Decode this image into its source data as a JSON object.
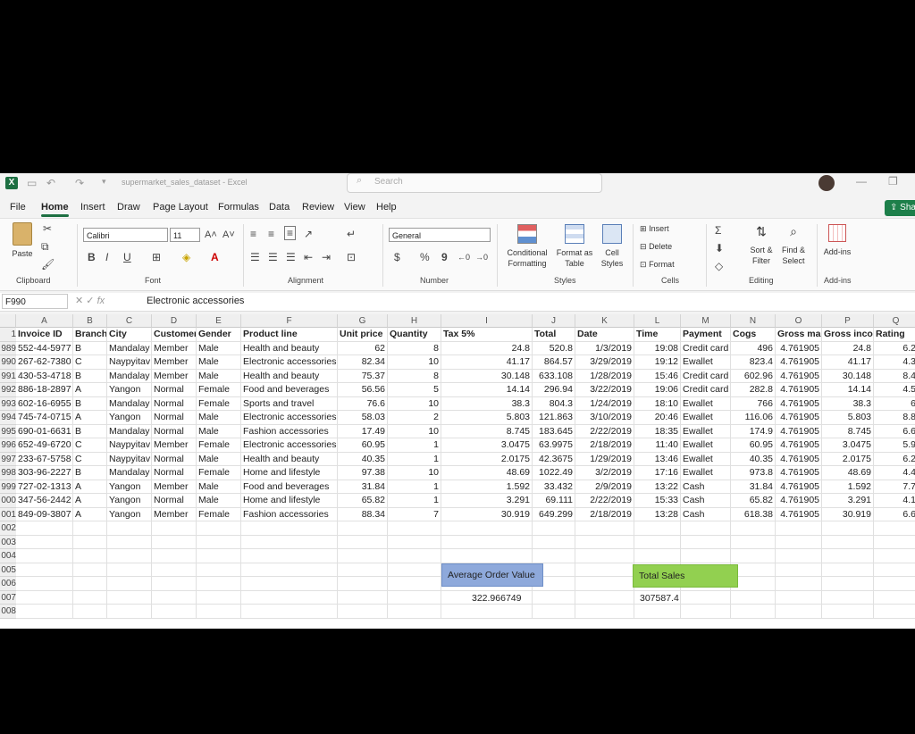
{
  "app": {
    "file_name": "supermarket_sales_dataset",
    "app_name": "Excel",
    "search_placeholder": "Search",
    "share_label": "Sha"
  },
  "menu": [
    "File",
    "Home",
    "Insert",
    "Draw",
    "Page Layout",
    "Formulas",
    "Data",
    "Review",
    "View",
    "Help"
  ],
  "ribbon": {
    "clipboard": {
      "paste": "Paste",
      "label": "Clipboard"
    },
    "font": {
      "name": "Calibri",
      "size": "11",
      "label": "Font",
      "bold": "B",
      "italic": "I",
      "underline": "U"
    },
    "alignment": {
      "label": "Alignment"
    },
    "number": {
      "format": "General",
      "label": "Number",
      "currency": "$",
      "percent": "%",
      "comma": "9"
    },
    "styles": {
      "conditional": "Conditional Formatting",
      "format_table": "Format as Table",
      "cell_styles": "Cell Styles",
      "label": "Styles"
    },
    "cells": {
      "insert": "Insert",
      "delete": "Delete",
      "format": "Format",
      "label": "Cells"
    },
    "editing": {
      "sort": "Sort & Filter",
      "find": "Find & Select",
      "label": "Editing"
    },
    "addins": {
      "button": "Add-ins",
      "label": "Add-ins"
    }
  },
  "formula_bar": {
    "name_box": "F990",
    "fx": "fx",
    "content": "Electronic accessories"
  },
  "columns": [
    "A",
    "B",
    "C",
    "D",
    "E",
    "F",
    "G",
    "H",
    "I",
    "J",
    "K",
    "L",
    "M",
    "N",
    "O",
    "P",
    "Q"
  ],
  "header_row": {
    "row_number": "1",
    "cells": [
      "Invoice ID",
      "Branch",
      "City",
      "Customer",
      "Gender",
      "Product line",
      "Unit price",
      "Quantity",
      "Tax 5%",
      "Total",
      "Date",
      "Time",
      "Payment",
      "Cogs",
      "Gross mar",
      "Gross incor",
      "Rating"
    ]
  },
  "rows": [
    {
      "n": "989",
      "c": [
        "552-44-5977",
        "B",
        "Mandalay",
        "Member",
        "Male",
        "Health and beauty",
        "62",
        "8",
        "24.8",
        "520.8",
        "1/3/2019",
        "19:08",
        "Credit card",
        "496",
        "4.761905",
        "24.8",
        "6.2"
      ]
    },
    {
      "n": "990",
      "c": [
        "267-62-7380",
        "C",
        "Naypyitav",
        "Member",
        "Male",
        "Electronic accessories",
        "82.34",
        "10",
        "41.17",
        "864.57",
        "3/29/2019",
        "19:12",
        "Ewallet",
        "823.4",
        "4.761905",
        "41.17",
        "4.3"
      ]
    },
    {
      "n": "991",
      "c": [
        "430-53-4718",
        "B",
        "Mandalay",
        "Member",
        "Male",
        "Health and beauty",
        "75.37",
        "8",
        "30.148",
        "633.108",
        "1/28/2019",
        "15:46",
        "Credit card",
        "602.96",
        "4.761905",
        "30.148",
        "8.4"
      ]
    },
    {
      "n": "992",
      "c": [
        "886-18-2897",
        "A",
        "Yangon",
        "Normal",
        "Female",
        "Food and beverages",
        "56.56",
        "5",
        "14.14",
        "296.94",
        "3/22/2019",
        "19:06",
        "Credit card",
        "282.8",
        "4.761905",
        "14.14",
        "4.5"
      ]
    },
    {
      "n": "993",
      "c": [
        "602-16-6955",
        "B",
        "Mandalay",
        "Normal",
        "Female",
        "Sports and travel",
        "76.6",
        "10",
        "38.3",
        "804.3",
        "1/24/2019",
        "18:10",
        "Ewallet",
        "766",
        "4.761905",
        "38.3",
        "6"
      ]
    },
    {
      "n": "994",
      "c": [
        "745-74-0715",
        "A",
        "Yangon",
        "Normal",
        "Male",
        "Electronic accessories",
        "58.03",
        "2",
        "5.803",
        "121.863",
        "3/10/2019",
        "20:46",
        "Ewallet",
        "116.06",
        "4.761905",
        "5.803",
        "8.8"
      ]
    },
    {
      "n": "995",
      "c": [
        "690-01-6631",
        "B",
        "Mandalay",
        "Normal",
        "Male",
        "Fashion accessories",
        "17.49",
        "10",
        "8.745",
        "183.645",
        "2/22/2019",
        "18:35",
        "Ewallet",
        "174.9",
        "4.761905",
        "8.745",
        "6.6"
      ]
    },
    {
      "n": "996",
      "c": [
        "652-49-6720",
        "C",
        "Naypyitav",
        "Member",
        "Female",
        "Electronic accessories",
        "60.95",
        "1",
        "3.0475",
        "63.9975",
        "2/18/2019",
        "11:40",
        "Ewallet",
        "60.95",
        "4.761905",
        "3.0475",
        "5.9"
      ]
    },
    {
      "n": "997",
      "c": [
        "233-67-5758",
        "C",
        "Naypyitav",
        "Normal",
        "Male",
        "Health and beauty",
        "40.35",
        "1",
        "2.0175",
        "42.3675",
        "1/29/2019",
        "13:46",
        "Ewallet",
        "40.35",
        "4.761905",
        "2.0175",
        "6.2"
      ]
    },
    {
      "n": "998",
      "c": [
        "303-96-2227",
        "B",
        "Mandalay",
        "Normal",
        "Female",
        "Home and lifestyle",
        "97.38",
        "10",
        "48.69",
        "1022.49",
        "3/2/2019",
        "17:16",
        "Ewallet",
        "973.8",
        "4.761905",
        "48.69",
        "4.4"
      ]
    },
    {
      "n": "999",
      "c": [
        "727-02-1313",
        "A",
        "Yangon",
        "Member",
        "Male",
        "Food and beverages",
        "31.84",
        "1",
        "1.592",
        "33.432",
        "2/9/2019",
        "13:22",
        "Cash",
        "31.84",
        "4.761905",
        "1.592",
        "7.7"
      ]
    },
    {
      "n": "000",
      "c": [
        "347-56-2442",
        "A",
        "Yangon",
        "Normal",
        "Male",
        "Home and lifestyle",
        "65.82",
        "1",
        "3.291",
        "69.111",
        "2/22/2019",
        "15:33",
        "Cash",
        "65.82",
        "4.761905",
        "3.291",
        "4.1"
      ]
    },
    {
      "n": "001",
      "c": [
        "849-09-3807",
        "A",
        "Yangon",
        "Member",
        "Female",
        "Fashion accessories",
        "88.34",
        "7",
        "30.919",
        "649.299",
        "2/18/2019",
        "13:28",
        "Cash",
        "618.38",
        "4.761905",
        "30.919",
        "6.6"
      ]
    }
  ],
  "empty_rows": [
    "002",
    "003",
    "004",
    "005",
    "006",
    "007",
    "008"
  ],
  "summary": {
    "avg_label": "Average Order Value",
    "avg_value": "322.966749",
    "total_label": "Total Sales",
    "total_value": "307587.4"
  }
}
